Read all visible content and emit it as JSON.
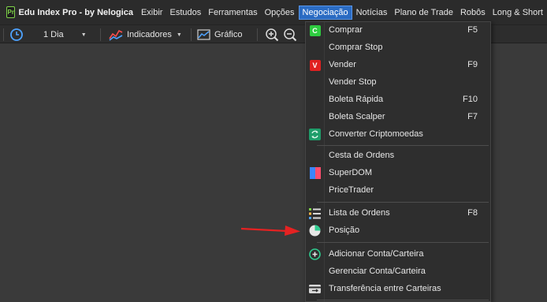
{
  "app": {
    "logo_text": "Pr",
    "title": "Edu Index Pro - by Nelogica"
  },
  "menubar": {
    "items": [
      {
        "label": "Exibir"
      },
      {
        "label": "Estudos"
      },
      {
        "label": "Ferramentas"
      },
      {
        "label": "Opções"
      },
      {
        "label": "Negociação",
        "active": true
      },
      {
        "label": "Notícias"
      },
      {
        "label": "Plano de Trade"
      },
      {
        "label": "Robôs"
      },
      {
        "label": "Long & Short"
      }
    ]
  },
  "toolbar": {
    "period_label": "1 Dia",
    "indicators_label": "Indicadores",
    "chart_label": "Gráfico"
  },
  "dropdown": {
    "items": [
      {
        "label": "Comprar",
        "shortcut": "F5",
        "icon": "buy-icon",
        "icon_text": "C"
      },
      {
        "label": "Comprar Stop",
        "shortcut": ""
      },
      {
        "label": "Vender",
        "shortcut": "F9",
        "icon": "sell-icon",
        "icon_text": "V"
      },
      {
        "label": "Vender Stop",
        "shortcut": ""
      },
      {
        "label": "Boleta Rápida",
        "shortcut": "F10"
      },
      {
        "label": "Boleta Scalper",
        "shortcut": "F7"
      },
      {
        "label": "Converter Criptomoedas",
        "shortcut": "",
        "icon": "convert-icon"
      },
      {
        "label": "Cesta de Ordens",
        "shortcut": ""
      },
      {
        "label": "SuperDOM",
        "shortcut": "",
        "icon": "superdom-icon"
      },
      {
        "label": "PriceTrader",
        "shortcut": ""
      },
      {
        "label": "Lista de Ordens",
        "shortcut": "F8",
        "icon": "order-list-icon"
      },
      {
        "label": "Posição",
        "shortcut": "",
        "icon": "position-pie-icon"
      },
      {
        "label": "Adicionar Conta/Carteira",
        "shortcut": "",
        "icon": "add-account-icon"
      },
      {
        "label": "Gerenciar Conta/Carteira",
        "shortcut": ""
      },
      {
        "label": "Transferência entre Carteiras",
        "shortcut": "",
        "icon": "transfer-icon"
      }
    ]
  },
  "colors": {
    "menubar_bg": "#2b2b2b",
    "active_menu": "#2b6cc4",
    "dropdown_bg": "#2e2e2e",
    "buy_green": "#2ecc40",
    "sell_red": "#e02020",
    "arrow_red": "#e52222",
    "workspace_bg": "#3a3a3a"
  }
}
